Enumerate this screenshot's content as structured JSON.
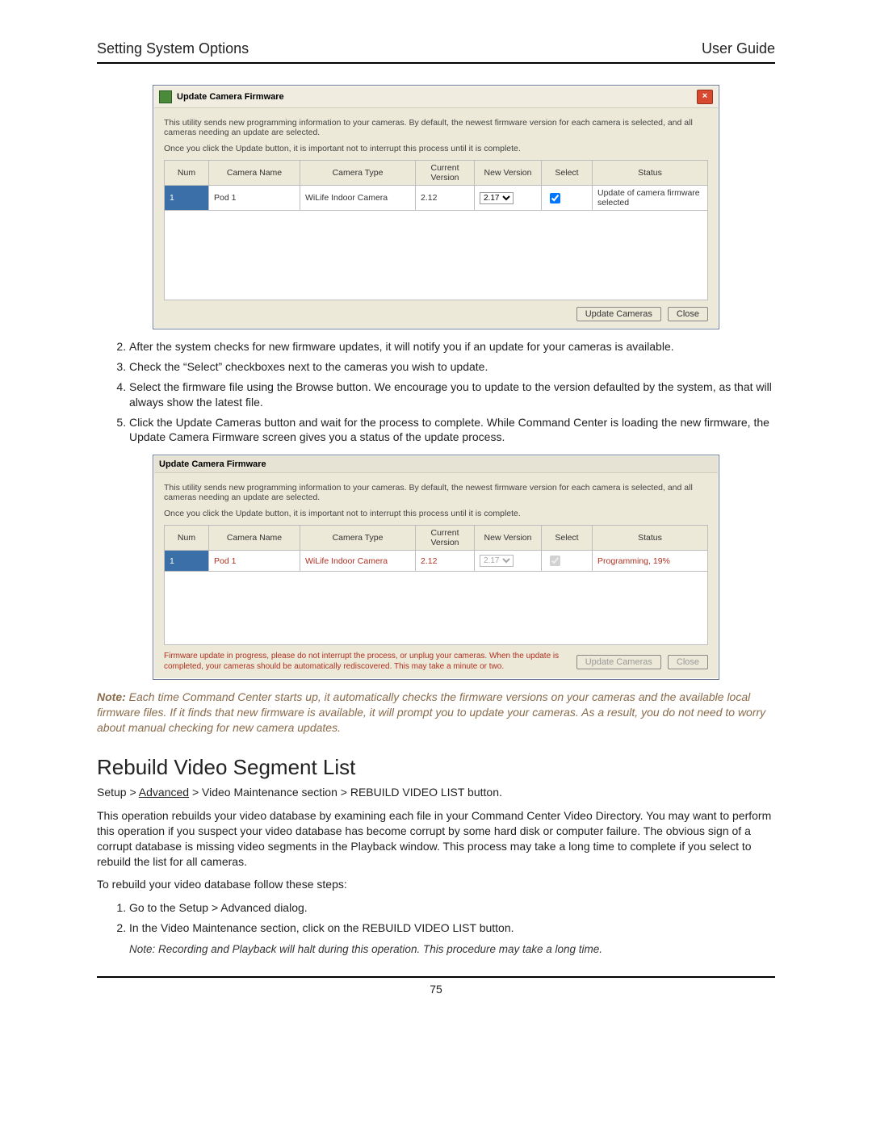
{
  "header": {
    "left": "Setting System Options",
    "right": "User Guide"
  },
  "dialog1": {
    "title": "Update Camera Firmware",
    "close_glyph": "×",
    "desc1": "This utility sends new programming information to your cameras.  By default, the newest firmware version for each camera is selected, and all cameras needing an update are selected.",
    "desc2": "Once you click the Update button, it is important not to interrupt this process until it is complete.",
    "cols": {
      "num": "Num",
      "name": "Camera Name",
      "type": "Camera Type",
      "cur": "Current Version",
      "new": "New Version",
      "sel": "Select",
      "status": "Status"
    },
    "row": {
      "num": "1",
      "name": "Pod 1",
      "type": "WiLife Indoor Camera",
      "cur": "2.12",
      "new": "2.17",
      "status": "Update of camera firmware selected"
    },
    "buttons": {
      "update": "Update Cameras",
      "close": "Close"
    }
  },
  "steps1": {
    "s2": "After the system checks for new firmware updates, it will notify you if an update for your cameras is available.",
    "s3": "Check the “Select” checkboxes next to the cameras you wish to update.",
    "s4": "Select the firmware file using the Browse button.  We encourage you to update to the version defaulted by the system, as that will always show the latest file.",
    "s5": "Click the Update Cameras button and wait for the process to complete.  While Command Center is loading the new firmware, the Update Camera Firmware screen gives you a status of the update process."
  },
  "dialog2": {
    "title": "Update Camera Firmware",
    "desc1": "This utility sends new programming information to your cameras.  By default, the newest firmware version for each camera is selected, and all cameras needing an update are selected.",
    "desc2": "Once you click the Update button, it is important not to interrupt this process until it is complete.",
    "cols": {
      "num": "Num",
      "name": "Camera Name",
      "type": "Camera Type",
      "cur": "Current Version",
      "new": "New Version",
      "sel": "Select",
      "status": "Status"
    },
    "row": {
      "num": "1",
      "name": "Pod 1",
      "type": "WiLife Indoor Camera",
      "cur": "2.12",
      "new": "2.17",
      "status": "Programming, 19%"
    },
    "warn": "Firmware update in progress, please do not interrupt the process, or unplug your cameras. When the update is completed, your cameras should be automatically rediscovered.  This may take a minute or two.",
    "buttons": {
      "update": "Update Cameras",
      "close": "Close"
    }
  },
  "note_block": {
    "label": "Note:",
    "text": " Each time Command Center starts up, it automatically checks the firmware versions on your cameras and the available local firmware files. If it finds that new firmware is available, it will prompt you to update your cameras. As a result, you do not need to worry about manual checking for new camera updates."
  },
  "section2": {
    "title": "Rebuild Video Segment List",
    "path_prefix": "Setup > ",
    "path_link": "Advanced",
    "path_suffix": " > Video Maintenance section > REBUILD VIDEO LIST button.",
    "para1": "This operation rebuilds your video database by examining each file in your Command Center Video Directory. You may want to perform this operation if you suspect your video database has become corrupt by some hard disk or computer failure. The obvious sign of a corrupt database is missing video segments in the Playback window. This process may take a long time to complete if you select to rebuild the list for all cameras.",
    "para2": "To rebuild your video database follow these steps:",
    "steps": {
      "s1": "Go to the Setup > Advanced dialog.",
      "s2": "In the Video Maintenance section, click on the REBUILD VIDEO LIST button.",
      "note": "Note: Recording and Playback will halt during this operation.  This procedure may take a long time."
    }
  },
  "page_number": "75"
}
